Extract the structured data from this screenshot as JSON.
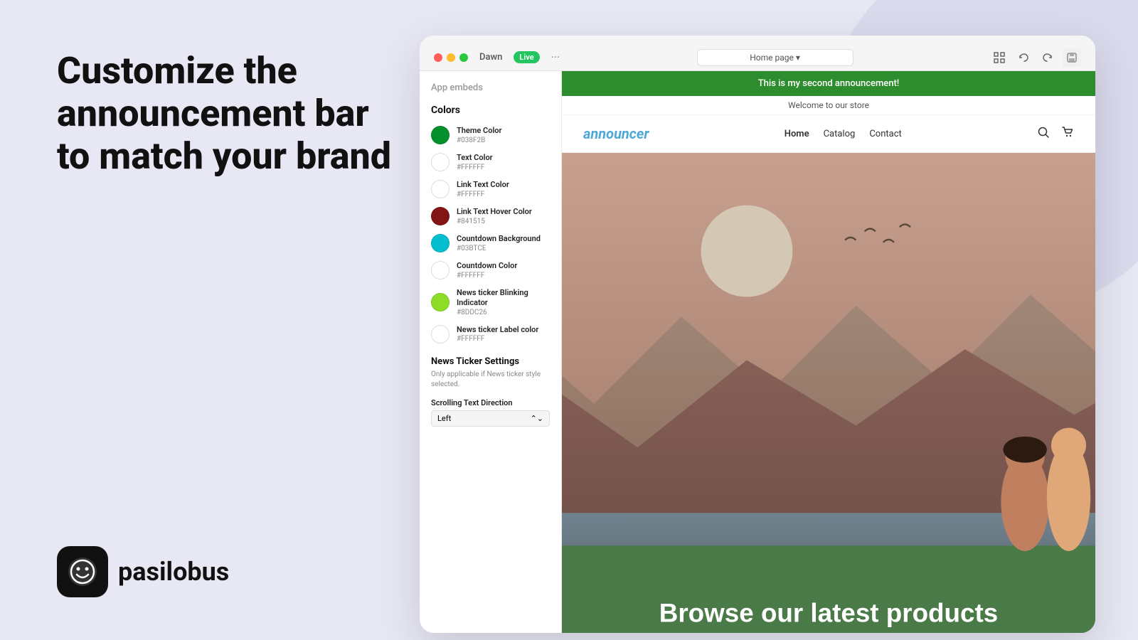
{
  "headline": "Customize the announcement bar to match your brand",
  "logo": {
    "brand": "pasilobus"
  },
  "browser": {
    "theme_name": "Dawn",
    "live_label": "Live",
    "menu_dots": "···",
    "address_bar": "Home page",
    "nav_icons": [
      "monitor",
      "undo",
      "redo",
      "save"
    ]
  },
  "sidebar": {
    "panel_title": "App embeds",
    "colors_section_title": "Colors",
    "color_rows": [
      {
        "id": "theme-color",
        "label": "Theme Color",
        "hex": "#038F2B",
        "swatch": "#038F2B"
      },
      {
        "id": "text-color",
        "label": "Text Color",
        "hex": "#FFFFFF",
        "swatch": "#FFFFFF"
      },
      {
        "id": "link-text-color",
        "label": "Link Text Color",
        "hex": "#FFFFFF",
        "swatch": "#FFFFFF"
      },
      {
        "id": "link-hover-color",
        "label": "Link Text Hover Color",
        "hex": "#841515",
        "swatch": "#841515"
      },
      {
        "id": "countdown-bg",
        "label": "Countdown Background",
        "hex": "#03BTCE",
        "swatch": "#03BECE"
      },
      {
        "id": "countdown-color",
        "label": "Countdown Color",
        "hex": "#FFFFFF",
        "swatch": "#FFFFFF"
      },
      {
        "id": "news-indicator",
        "label": "News ticker Blinking Indicator",
        "hex": "#8DDC26",
        "swatch": "#8DDC26"
      },
      {
        "id": "news-label-color",
        "label": "News ticker Label color",
        "hex": "#FFFFFF",
        "swatch": "#FFFFFF"
      }
    ],
    "news_ticker_title": "News Ticker Settings",
    "news_ticker_desc": "Only applicable if News ticker style selected.",
    "scrolling_text_label": "Scrolling Text Direction",
    "scrolling_text_value": "Left"
  },
  "website": {
    "announcement_text": "This is my second announcement!",
    "sub_bar_text": "Welcome to our store",
    "logo_text": "announcer",
    "nav_links": [
      {
        "label": "Home",
        "active": true
      },
      {
        "label": "Catalog",
        "active": false
      },
      {
        "label": "Contact",
        "active": false
      }
    ],
    "hero_text": "Browse our latest products"
  }
}
